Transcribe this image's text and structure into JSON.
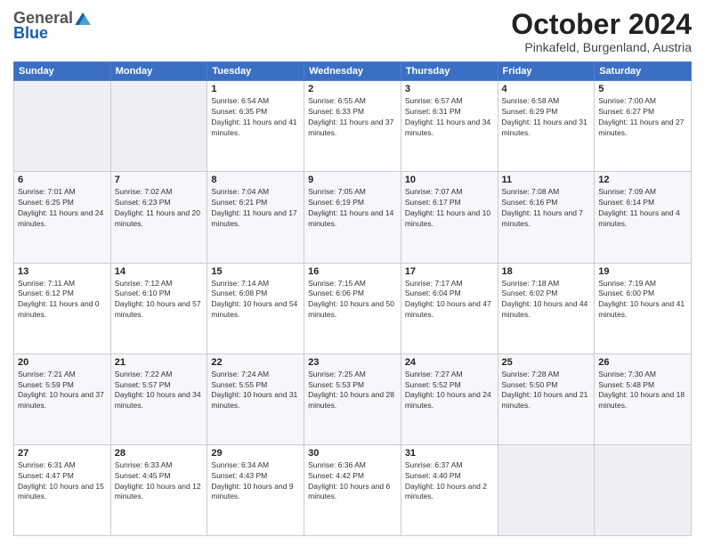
{
  "logo": {
    "general": "General",
    "blue": "Blue"
  },
  "header": {
    "month": "October 2024",
    "location": "Pinkafeld, Burgenland, Austria"
  },
  "weekdays": [
    "Sunday",
    "Monday",
    "Tuesday",
    "Wednesday",
    "Thursday",
    "Friday",
    "Saturday"
  ],
  "weeks": [
    [
      {
        "day": "",
        "info": ""
      },
      {
        "day": "",
        "info": ""
      },
      {
        "day": "1",
        "info": "Sunrise: 6:54 AM\nSunset: 6:35 PM\nDaylight: 11 hours and 41 minutes."
      },
      {
        "day": "2",
        "info": "Sunrise: 6:55 AM\nSunset: 6:33 PM\nDaylight: 11 hours and 37 minutes."
      },
      {
        "day": "3",
        "info": "Sunrise: 6:57 AM\nSunset: 6:31 PM\nDaylight: 11 hours and 34 minutes."
      },
      {
        "day": "4",
        "info": "Sunrise: 6:58 AM\nSunset: 6:29 PM\nDaylight: 11 hours and 31 minutes."
      },
      {
        "day": "5",
        "info": "Sunrise: 7:00 AM\nSunset: 6:27 PM\nDaylight: 11 hours and 27 minutes."
      }
    ],
    [
      {
        "day": "6",
        "info": "Sunrise: 7:01 AM\nSunset: 6:25 PM\nDaylight: 11 hours and 24 minutes."
      },
      {
        "day": "7",
        "info": "Sunrise: 7:02 AM\nSunset: 6:23 PM\nDaylight: 11 hours and 20 minutes."
      },
      {
        "day": "8",
        "info": "Sunrise: 7:04 AM\nSunset: 6:21 PM\nDaylight: 11 hours and 17 minutes."
      },
      {
        "day": "9",
        "info": "Sunrise: 7:05 AM\nSunset: 6:19 PM\nDaylight: 11 hours and 14 minutes."
      },
      {
        "day": "10",
        "info": "Sunrise: 7:07 AM\nSunset: 6:17 PM\nDaylight: 11 hours and 10 minutes."
      },
      {
        "day": "11",
        "info": "Sunrise: 7:08 AM\nSunset: 6:16 PM\nDaylight: 11 hours and 7 minutes."
      },
      {
        "day": "12",
        "info": "Sunrise: 7:09 AM\nSunset: 6:14 PM\nDaylight: 11 hours and 4 minutes."
      }
    ],
    [
      {
        "day": "13",
        "info": "Sunrise: 7:11 AM\nSunset: 6:12 PM\nDaylight: 11 hours and 0 minutes."
      },
      {
        "day": "14",
        "info": "Sunrise: 7:12 AM\nSunset: 6:10 PM\nDaylight: 10 hours and 57 minutes."
      },
      {
        "day": "15",
        "info": "Sunrise: 7:14 AM\nSunset: 6:08 PM\nDaylight: 10 hours and 54 minutes."
      },
      {
        "day": "16",
        "info": "Sunrise: 7:15 AM\nSunset: 6:06 PM\nDaylight: 10 hours and 50 minutes."
      },
      {
        "day": "17",
        "info": "Sunrise: 7:17 AM\nSunset: 6:04 PM\nDaylight: 10 hours and 47 minutes."
      },
      {
        "day": "18",
        "info": "Sunrise: 7:18 AM\nSunset: 6:02 PM\nDaylight: 10 hours and 44 minutes."
      },
      {
        "day": "19",
        "info": "Sunrise: 7:19 AM\nSunset: 6:00 PM\nDaylight: 10 hours and 41 minutes."
      }
    ],
    [
      {
        "day": "20",
        "info": "Sunrise: 7:21 AM\nSunset: 5:59 PM\nDaylight: 10 hours and 37 minutes."
      },
      {
        "day": "21",
        "info": "Sunrise: 7:22 AM\nSunset: 5:57 PM\nDaylight: 10 hours and 34 minutes."
      },
      {
        "day": "22",
        "info": "Sunrise: 7:24 AM\nSunset: 5:55 PM\nDaylight: 10 hours and 31 minutes."
      },
      {
        "day": "23",
        "info": "Sunrise: 7:25 AM\nSunset: 5:53 PM\nDaylight: 10 hours and 28 minutes."
      },
      {
        "day": "24",
        "info": "Sunrise: 7:27 AM\nSunset: 5:52 PM\nDaylight: 10 hours and 24 minutes."
      },
      {
        "day": "25",
        "info": "Sunrise: 7:28 AM\nSunset: 5:50 PM\nDaylight: 10 hours and 21 minutes."
      },
      {
        "day": "26",
        "info": "Sunrise: 7:30 AM\nSunset: 5:48 PM\nDaylight: 10 hours and 18 minutes."
      }
    ],
    [
      {
        "day": "27",
        "info": "Sunrise: 6:31 AM\nSunset: 4:47 PM\nDaylight: 10 hours and 15 minutes."
      },
      {
        "day": "28",
        "info": "Sunrise: 6:33 AM\nSunset: 4:45 PM\nDaylight: 10 hours and 12 minutes."
      },
      {
        "day": "29",
        "info": "Sunrise: 6:34 AM\nSunset: 4:43 PM\nDaylight: 10 hours and 9 minutes."
      },
      {
        "day": "30",
        "info": "Sunrise: 6:36 AM\nSunset: 4:42 PM\nDaylight: 10 hours and 6 minutes."
      },
      {
        "day": "31",
        "info": "Sunrise: 6:37 AM\nSunset: 4:40 PM\nDaylight: 10 hours and 2 minutes."
      },
      {
        "day": "",
        "info": ""
      },
      {
        "day": "",
        "info": ""
      }
    ]
  ]
}
